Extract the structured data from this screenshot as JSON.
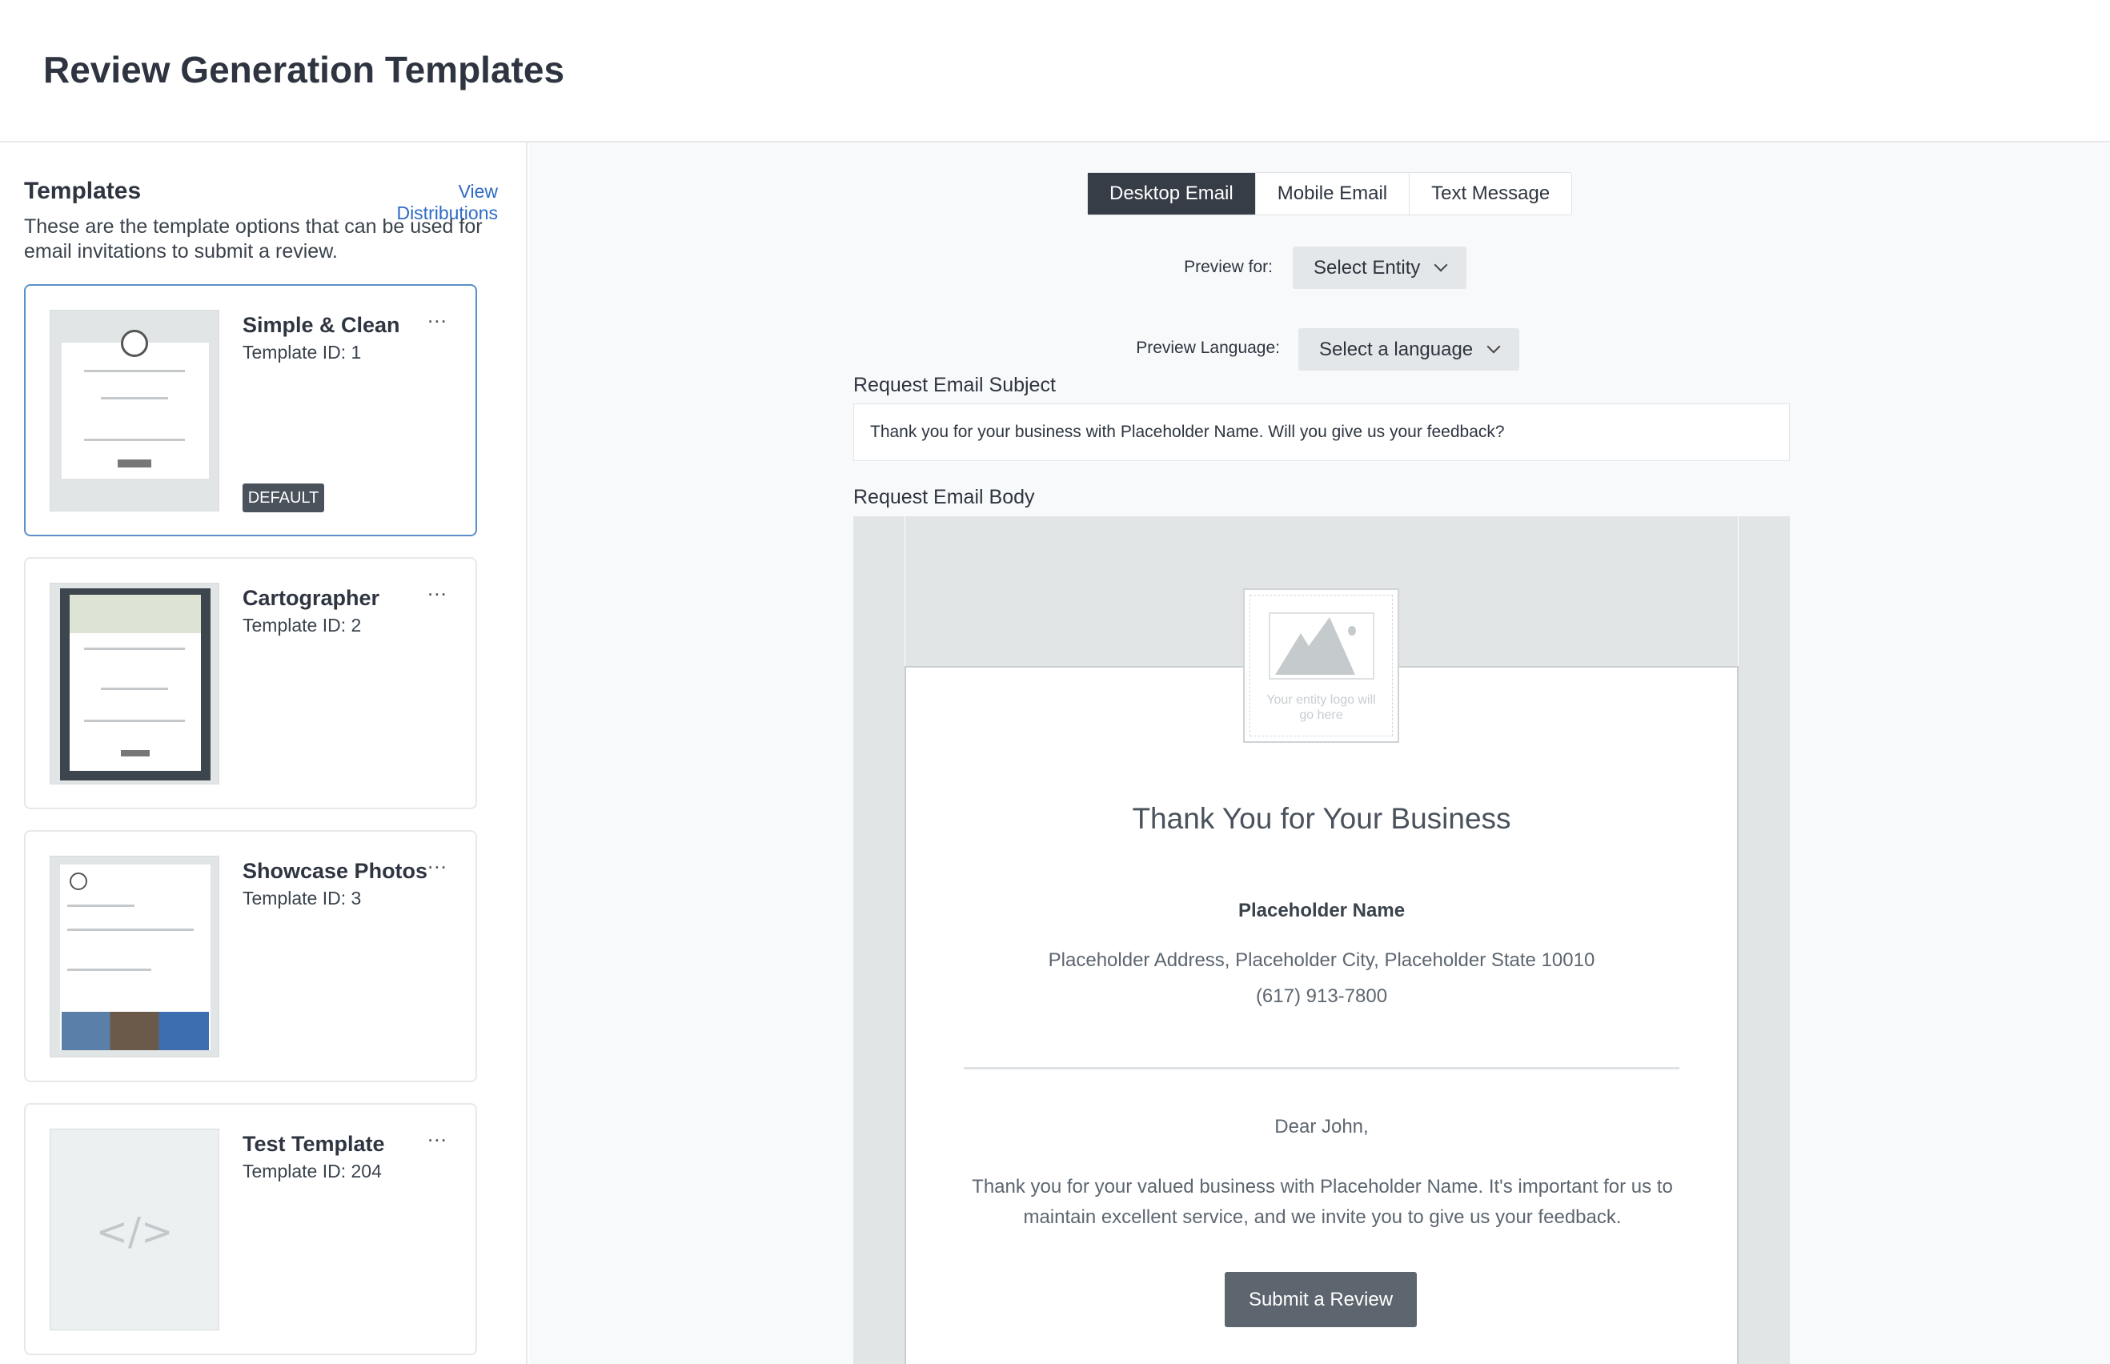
{
  "header": {
    "title": "Review Generation Templates"
  },
  "sidebar": {
    "title": "Templates",
    "view_distributions": "View Distributions",
    "description": "These are the template options that can be used for email invitations to submit a review.",
    "cards": [
      {
        "name": "Simple & Clean",
        "id": "Template ID: 1",
        "badge": "DEFAULT",
        "selected": true
      },
      {
        "name": "Cartographer",
        "id": "Template ID: 2"
      },
      {
        "name": "Showcase Photos",
        "id": "Template ID: 3"
      },
      {
        "name": "Test Template",
        "id": "Template ID: 204",
        "thumb_icon": "</>"
      }
    ],
    "more_icon": "..."
  },
  "main": {
    "tabs": [
      {
        "label": "Desktop Email",
        "active": true
      },
      {
        "label": "Mobile Email"
      },
      {
        "label": "Text Message"
      }
    ],
    "preview_for_label": "Preview for:",
    "preview_for_value": "Select Entity",
    "preview_language_label": "Preview Language:",
    "preview_language_value": "Select a language",
    "subject_label": "Request Email Subject",
    "subject_value": "Thank you for your business with Placeholder Name. Will you give us your feedback?",
    "body_label": "Request Email Body",
    "email": {
      "logo_placeholder": "Your entity logo will go here",
      "heading": "Thank You for Your Business",
      "name": "Placeholder Name",
      "address": "Placeholder Address, Placeholder City, Placeholder State 10010",
      "phone": "(617) 913-7800",
      "greeting": "Dear John,",
      "message": "Thank you for your valued business with Placeholder Name. It's important for us to maintain excellent service, and we invite you to give us your feedback.",
      "button": "Submit a Review"
    }
  },
  "colors": {
    "accent": "#2f6bc6",
    "active_tab": "#363d47",
    "button": "#5d666e"
  }
}
